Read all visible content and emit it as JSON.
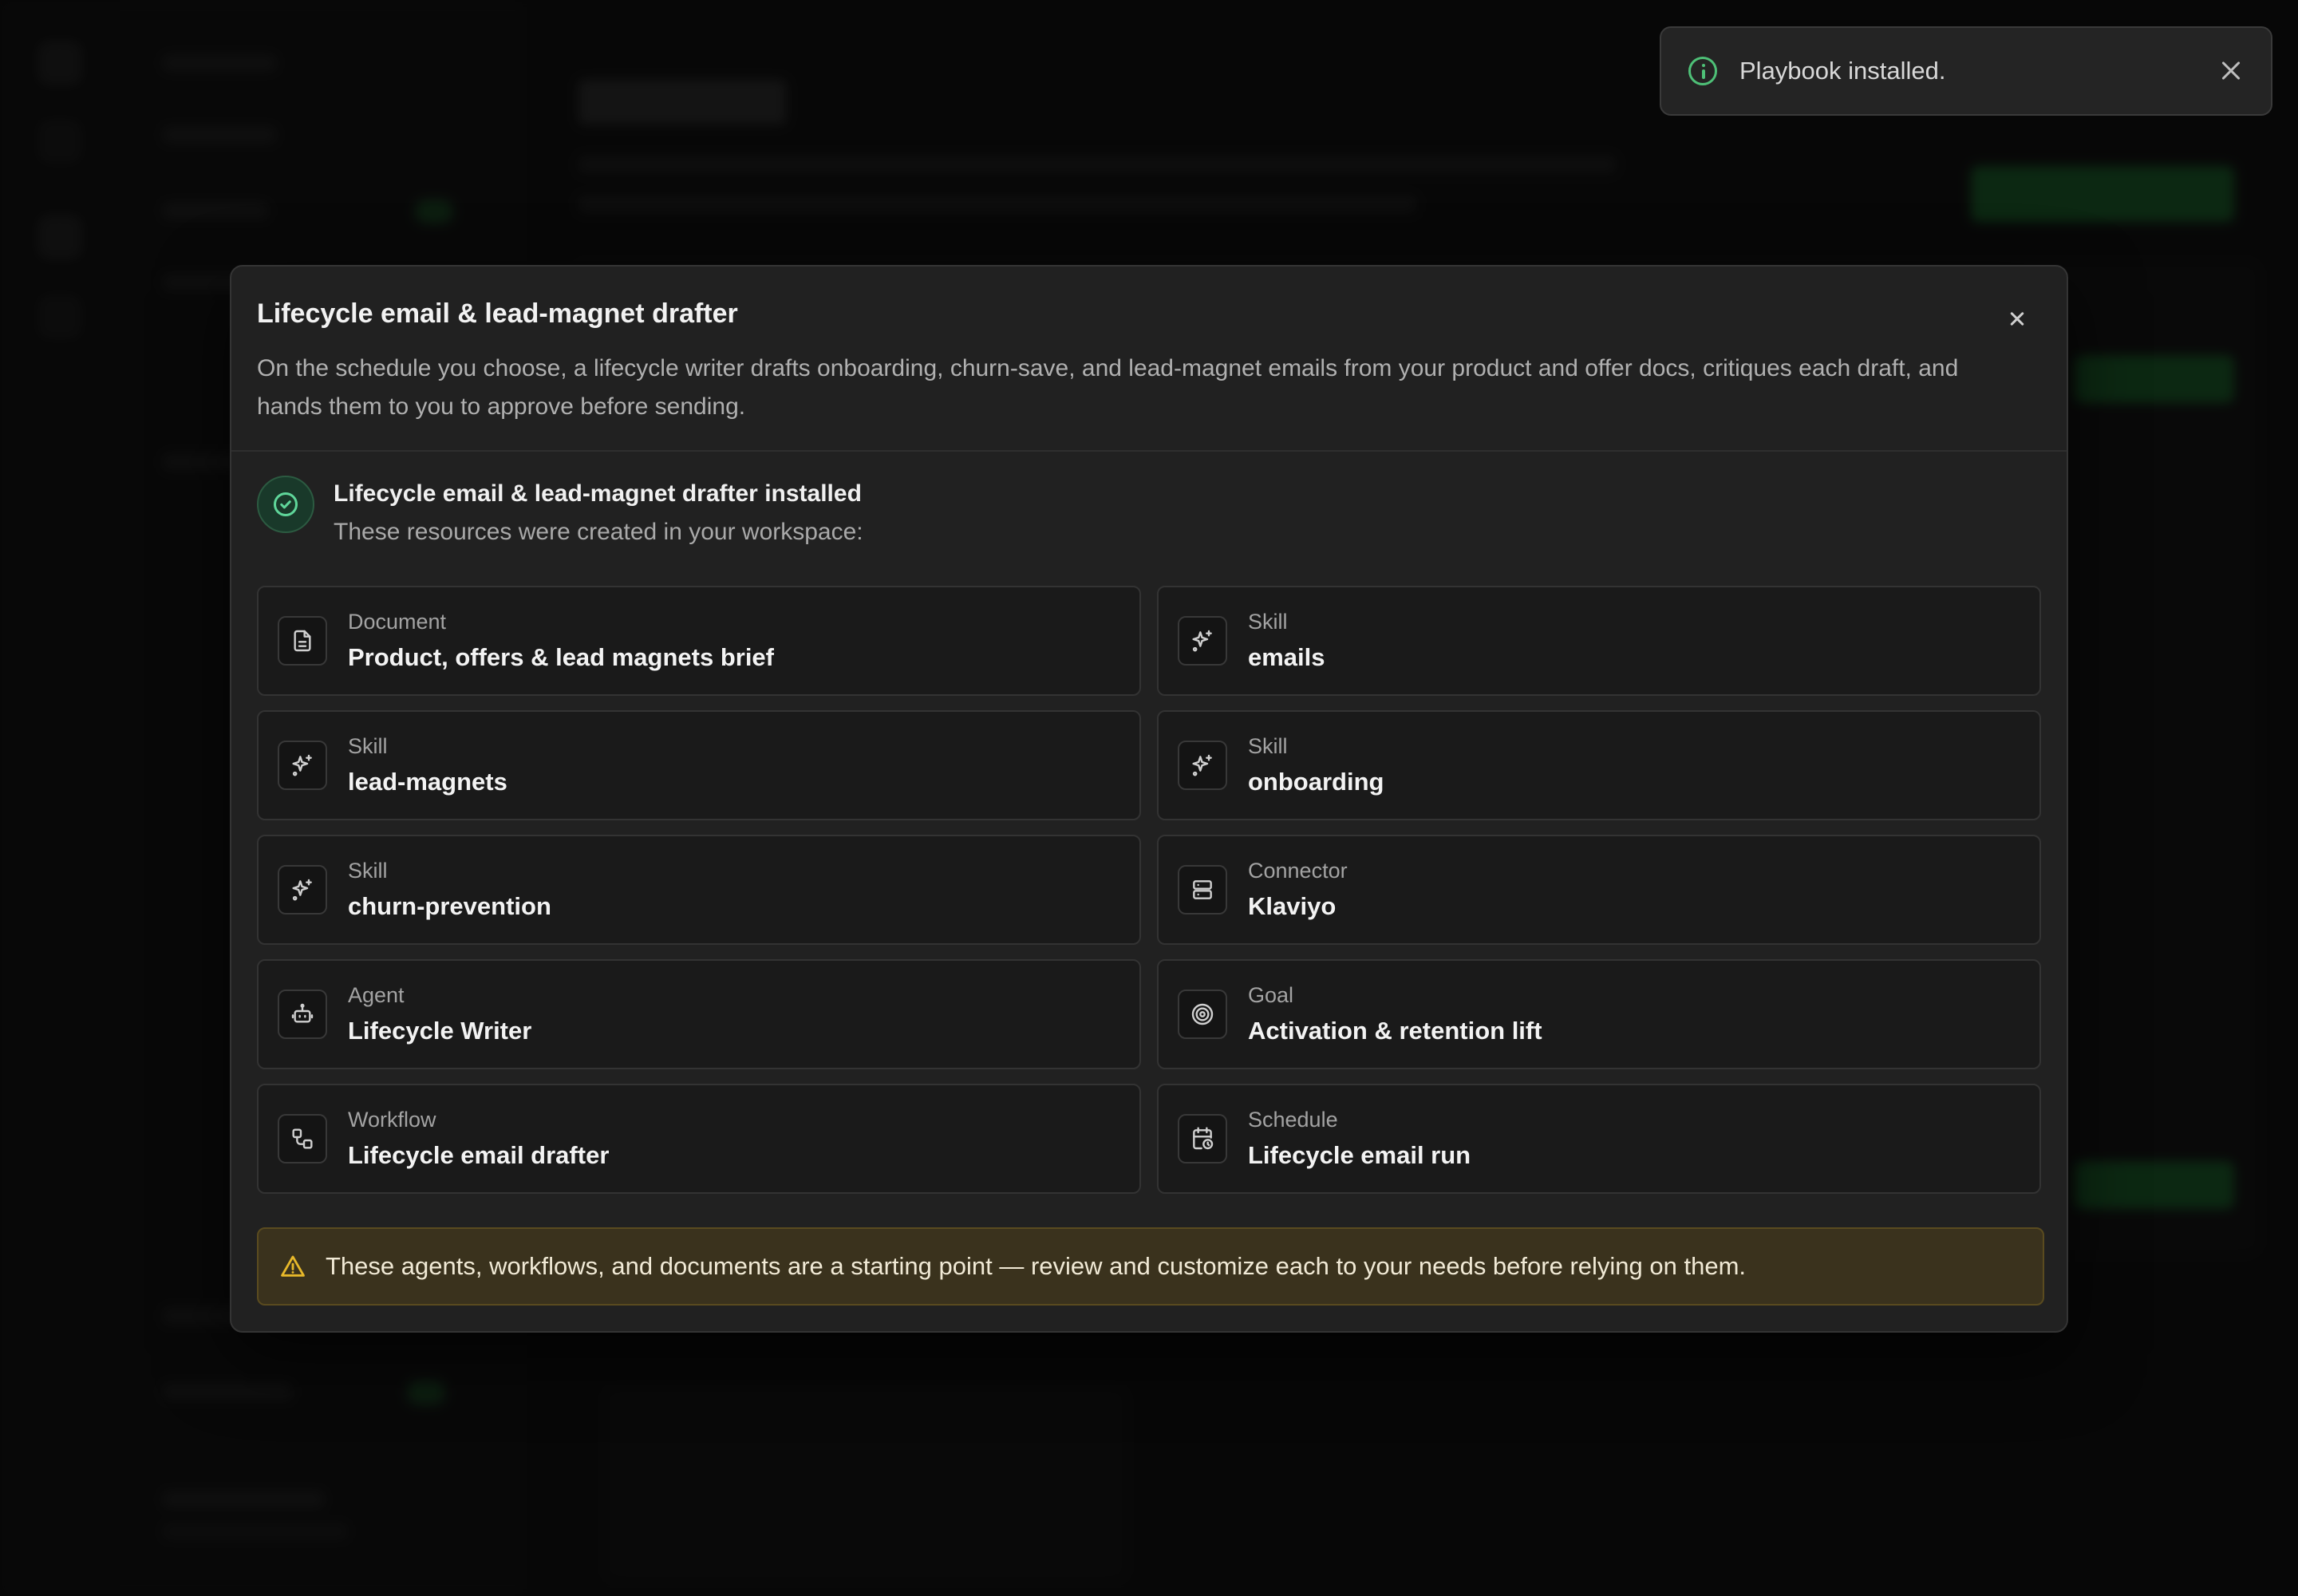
{
  "toast": {
    "message": "Playbook installed.",
    "icon": "info-circle-icon",
    "accent": "#4ec077"
  },
  "modal": {
    "title": "Lifecycle email & lead-magnet drafter",
    "description": "On the schedule you choose, a lifecycle writer drafts onboarding, churn-save, and lead-magnet emails from your product and offer docs, critiques each draft, and hands them to you to approve before sending.",
    "status": {
      "title": "Lifecycle email & lead-magnet drafter installed",
      "subtitle": "These resources were created in your workspace:",
      "icon": "check-circle-icon",
      "accent": "#5fd69a"
    },
    "resources": [
      {
        "type": "Document",
        "name": "Product, offers & lead magnets brief",
        "icon": "document-icon"
      },
      {
        "type": "Skill",
        "name": "emails",
        "icon": "sparkle-icon"
      },
      {
        "type": "Skill",
        "name": "lead-magnets",
        "icon": "sparkle-icon"
      },
      {
        "type": "Skill",
        "name": "onboarding",
        "icon": "sparkle-icon"
      },
      {
        "type": "Skill",
        "name": "churn-prevention",
        "icon": "sparkle-icon"
      },
      {
        "type": "Connector",
        "name": "Klaviyo",
        "icon": "server-icon"
      },
      {
        "type": "Agent",
        "name": "Lifecycle Writer",
        "icon": "robot-icon"
      },
      {
        "type": "Goal",
        "name": "Activation & retention lift",
        "icon": "target-icon"
      },
      {
        "type": "Workflow",
        "name": "Lifecycle email drafter",
        "icon": "workflow-icon"
      },
      {
        "type": "Schedule",
        "name": "Lifecycle email run",
        "icon": "calendar-clock-icon"
      }
    ],
    "warning": {
      "text": "These agents, workflows, and documents are a starting point — review and customize each to your needs before relying on them.",
      "icon": "warning-triangle-icon",
      "accent": "#e8b92a"
    }
  }
}
